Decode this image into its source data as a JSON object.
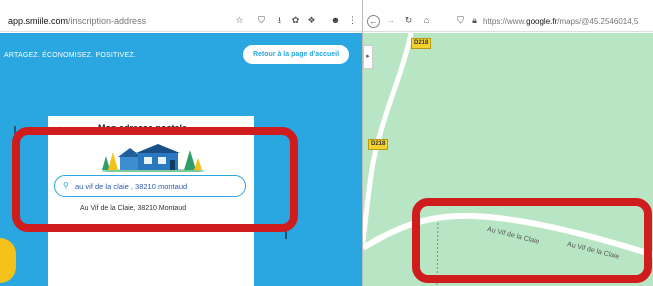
{
  "left_browser": {
    "url_host": "app.smiile.com",
    "url_path": "/inscription-address",
    "toolbar_icons": [
      "star-icon",
      "shield-icon",
      "download-icon",
      "extension-icon",
      "extension-icon",
      "account-icon",
      "menu-icon"
    ]
  },
  "smiile_page": {
    "tagline": "ARTAGEZ. ÉCONOMISEZ. POSITIVEZ.",
    "home_button": "Retour à la page d'accueil",
    "card_title": "Mon adresse postale",
    "address_input": {
      "value": "au vif de la claie ,  38210 montaud"
    },
    "suggestion": "Au Vif de la Claie, 38210 Montaud",
    "colors": {
      "brand_blue": "#2aa6e0",
      "accent_yellow": "#f4c21a"
    }
  },
  "right_browser": {
    "url_prefix": "https://www.",
    "url_host": "google.fr",
    "url_path": "/maps/@45.2546014,5",
    "nav_icons": [
      "back-icon",
      "forward-icon",
      "reload-icon",
      "home-icon"
    ]
  },
  "map": {
    "route_badges": [
      "D218",
      "D218"
    ],
    "road_labels": [
      "Au Vif de la Claie",
      "Au Vif de la Claie"
    ],
    "colors": {
      "land": "#b8e6c4",
      "road": "#ffffff",
      "highlight": "#cf1c1c"
    }
  }
}
